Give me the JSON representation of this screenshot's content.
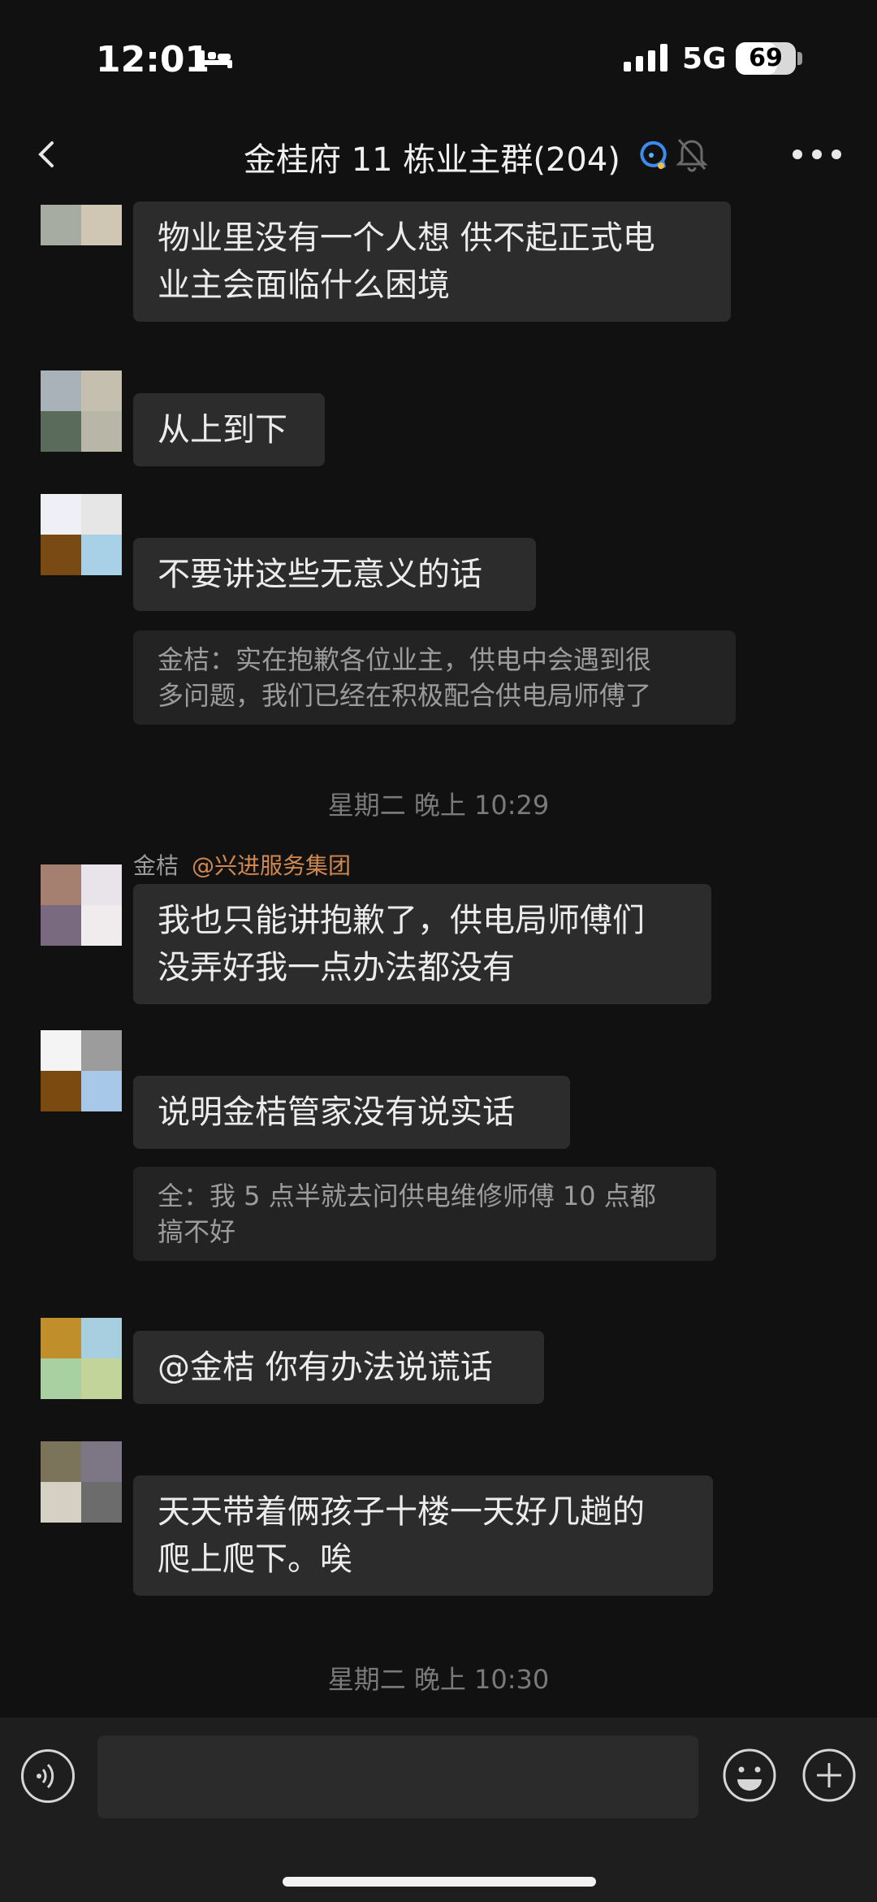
{
  "status_bar": {
    "time": "12:01",
    "network": "5G",
    "battery": "69",
    "battery_level": 0.69
  },
  "header": {
    "title": "金桂府 11 栋业主群(204)",
    "back_icon": "chevron-left-icon",
    "ai_icon": "ai-assistant-icon",
    "mute_icon": "bell-muted-icon",
    "more_icon": "more-dots-icon"
  },
  "messages": [
    {
      "lines": [
        "物业里没有一个人想 供不起正式电",
        "业主会面临什么困境"
      ]
    },
    {
      "lines": [
        "从上到下"
      ]
    },
    {
      "lines": [
        "不要讲这些无意义的话"
      ],
      "quote": [
        "金桔：实在抱歉各位业主，供电中会遇到很",
        "多问题，我们已经在积极配合供电局师傅了"
      ]
    },
    {
      "timestamp": "星期二 晚上 10:29"
    },
    {
      "sender": "金桔",
      "sender_tag": "@兴进服务集团",
      "lines": [
        "我也只能讲抱歉了，供电局师傅们",
        "没弄好我一点办法都没有"
      ]
    },
    {
      "lines": [
        "说明金桔管家没有说实话"
      ],
      "quote": [
        "全：我 5 点半就去问供电维修师傅 10 点都",
        "搞不好"
      ]
    },
    {
      "lines": [
        "@金桔 你有办法说谎话"
      ]
    },
    {
      "lines": [
        "天天带着俩孩子十楼一天好几趟的",
        "爬上爬下。唉"
      ]
    },
    {
      "timestamp": "星期二 晚上 10:30"
    }
  ],
  "input_bar": {
    "placeholder": "",
    "voice_icon": "voice-icon",
    "emoji_icon": "emoji-icon",
    "plus_icon": "plus-icon"
  }
}
